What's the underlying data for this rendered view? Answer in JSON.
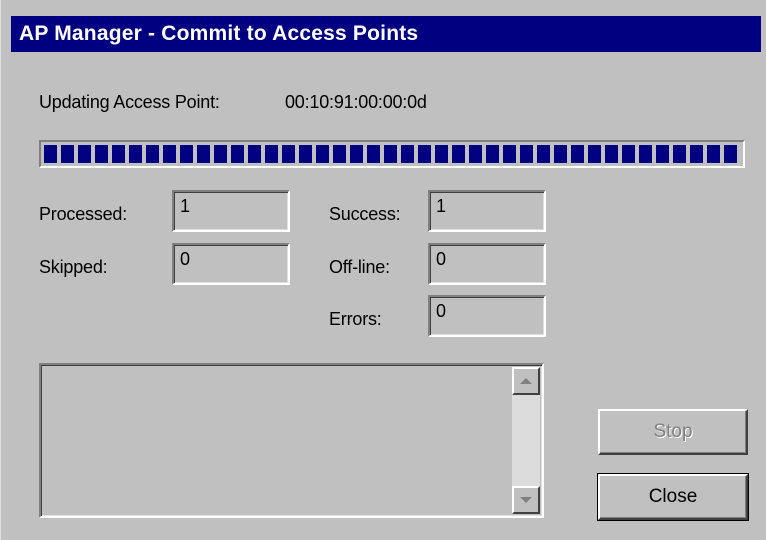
{
  "window": {
    "title": "AP Manager - Commit to Access Points"
  },
  "status": {
    "label": "Updating Access Point:",
    "value": "00:10:91:00:00:0d"
  },
  "progress": {
    "fraction": 1.0
  },
  "counters": {
    "processed": {
      "label": "Processed:",
      "value": "1"
    },
    "skipped": {
      "label": "Skipped:",
      "value": "0"
    },
    "success": {
      "label": "Success:",
      "value": "1"
    },
    "offline": {
      "label": "Off-line:",
      "value": "0"
    },
    "errors": {
      "label": "Errors:",
      "value": "0"
    }
  },
  "log": {
    "text": ""
  },
  "buttons": {
    "stop": "Stop",
    "close": "Close"
  },
  "colors": {
    "titlebar": "#000080",
    "progress": "#000080",
    "face": "#c0c0c0"
  },
  "icons": {
    "scroll_up": "scroll-up-arrow-icon",
    "scroll_down": "scroll-down-arrow-icon"
  }
}
